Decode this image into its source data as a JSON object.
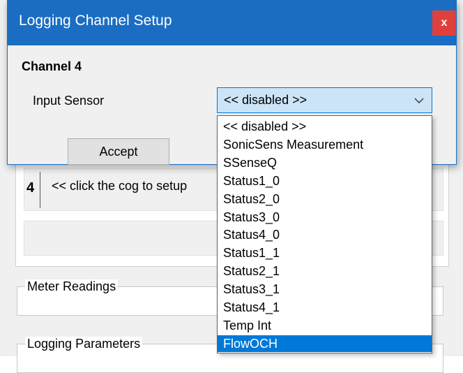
{
  "dialog": {
    "title": "Logging Channel Setup",
    "close_label": "x",
    "channel_title": "Channel 4",
    "sensor_label": "Input Sensor",
    "accept_label": "Accept"
  },
  "combo": {
    "selected": "<< disabled >>",
    "icon": "chevron-down-icon"
  },
  "dropdown": {
    "options": [
      "<< disabled >>",
      "SonicSens Measurement",
      "SSenseQ",
      "Status1_0",
      "Status2_0",
      "Status3_0",
      "Status4_0",
      "Status1_1",
      "Status2_1",
      "Status3_1",
      "Status4_1",
      "Temp Int",
      "FlowOCH"
    ],
    "highlighted": "FlowOCH"
  },
  "background": {
    "channel_number": "4",
    "channel_hint": "<<  click the cog to setup",
    "meter_readings": "Meter Readings",
    "logging_parameters": "Logging Parameters"
  },
  "colors": {
    "titlebar": "#1a6dc3",
    "close": "#e0403c",
    "selection": "#0078d7"
  }
}
